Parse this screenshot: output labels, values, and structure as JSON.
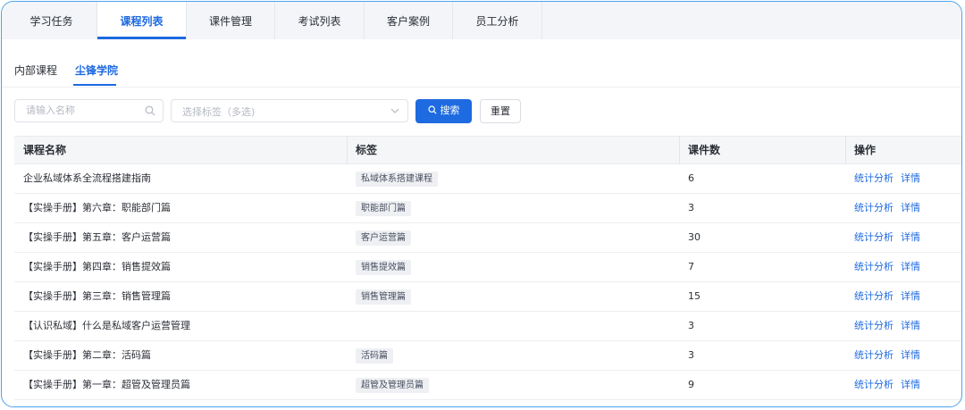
{
  "tabs": [
    {
      "label": "学习任务"
    },
    {
      "label": "课程列表"
    },
    {
      "label": "课件管理"
    },
    {
      "label": "考试列表"
    },
    {
      "label": "客户案例"
    },
    {
      "label": "员工分析"
    }
  ],
  "subtabs": [
    {
      "label": "内部课程"
    },
    {
      "label": "尘锋学院"
    }
  ],
  "filters": {
    "name_placeholder": "请输入名称",
    "tags_placeholder": "选择标签（多选)",
    "search_label": "搜索",
    "reset_label": "重置"
  },
  "table": {
    "columns": [
      "课程名称",
      "标签",
      "课件数",
      "操作"
    ],
    "rows": [
      {
        "name": "企业私域体系全流程搭建指南",
        "tag": "私域体系搭建课程",
        "count": "6"
      },
      {
        "name": "【实操手册】第六章：职能部门篇",
        "tag": "职能部门篇",
        "count": "3"
      },
      {
        "name": "【实操手册】第五章：客户运营篇",
        "tag": "客户运营篇",
        "count": "30"
      },
      {
        "name": "【实操手册】第四章：销售提效篇",
        "tag": "销售提效篇",
        "count": "7"
      },
      {
        "name": "【实操手册】第三章：销售管理篇",
        "tag": "销售管理篇",
        "count": "15"
      },
      {
        "name": "【认识私域】什么是私域客户运营管理",
        "tag": "",
        "count": "3"
      },
      {
        "name": "【实操手册】第二章：活码篇",
        "tag": "活码篇",
        "count": "3"
      },
      {
        "name": "【实操手册】第一章：超管及管理员篇",
        "tag": "超管及管理员篇",
        "count": "9"
      }
    ],
    "action_stats": "统计分析",
    "action_detail": "详情"
  },
  "colors": {
    "accent": "#1e6ae0",
    "frame": "#4aa3f0"
  }
}
